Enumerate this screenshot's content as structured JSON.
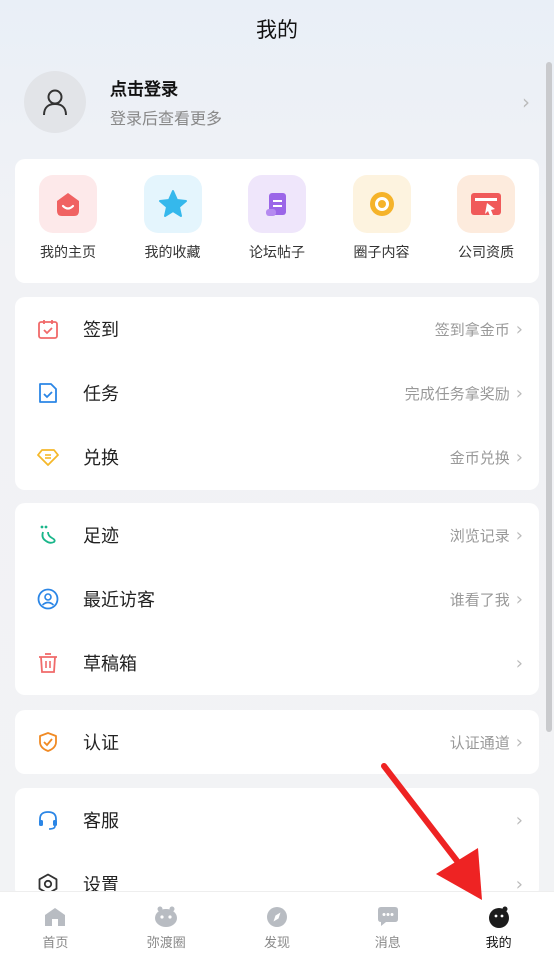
{
  "header": {
    "title": "我的"
  },
  "profile": {
    "login_title": "点击登录",
    "login_sub": "登录后查看更多"
  },
  "quick_items": [
    {
      "label": "我的主页",
      "icon": "home-page-icon"
    },
    {
      "label": "我的收藏",
      "icon": "star-icon"
    },
    {
      "label": "论坛帖子",
      "icon": "scroll-icon"
    },
    {
      "label": "圈子内容",
      "icon": "circle-icon"
    },
    {
      "label": "公司资质",
      "icon": "certificate-icon"
    }
  ],
  "group1": [
    {
      "label": "签到",
      "hint": "签到拿金币",
      "icon": "calendar-check-icon"
    },
    {
      "label": "任务",
      "hint": "完成任务拿奖励",
      "icon": "task-icon"
    },
    {
      "label": "兑换",
      "hint": "金币兑换",
      "icon": "diamond-exchange-icon"
    }
  ],
  "group2": [
    {
      "label": "足迹",
      "hint": "浏览记录",
      "icon": "footprint-icon"
    },
    {
      "label": "最近访客",
      "hint": "谁看了我",
      "icon": "visitor-icon"
    },
    {
      "label": "草稿箱",
      "hint": "",
      "icon": "trash-box-icon"
    }
  ],
  "group3": [
    {
      "label": "认证",
      "hint": "认证通道",
      "icon": "shield-check-icon"
    }
  ],
  "group4": [
    {
      "label": "客服",
      "hint": "",
      "icon": "headset-icon"
    },
    {
      "label": "设置",
      "hint": "",
      "icon": "settings-icon"
    }
  ],
  "tabs": [
    {
      "label": "首页",
      "icon": "home-icon"
    },
    {
      "label": "弥渡圈",
      "icon": "community-icon"
    },
    {
      "label": "发现",
      "icon": "compass-icon"
    },
    {
      "label": "消息",
      "icon": "message-icon"
    },
    {
      "label": "我的",
      "icon": "me-icon",
      "active": true
    }
  ],
  "colors": {
    "accent_red": "#f04141",
    "primary_blue": "#1e88e5"
  }
}
